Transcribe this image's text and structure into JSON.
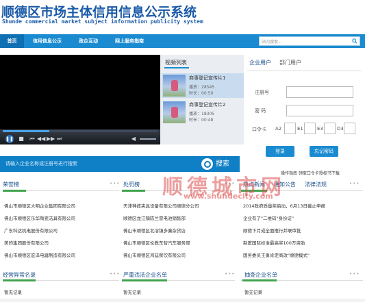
{
  "header": {
    "title": "顺德区市场主体信用信息公示系统",
    "subtitle": "Shunde commercial market subject information publicity system"
  },
  "nav": {
    "items": [
      "首页",
      "信用信息公示",
      "政企互动",
      "网上服务指南"
    ],
    "search_placeholder": "站内搜索..."
  },
  "video_list": {
    "title": "视频列表",
    "items": [
      {
        "name": "商事登记宣传片1",
        "plays": "播放：28545",
        "duration": "时长：00:50"
      },
      {
        "name": "商事登记宣传片2",
        "plays": "播放：18305",
        "duration": "时长：00:48"
      }
    ]
  },
  "player": {
    "progress": 0.3
  },
  "login": {
    "tabs": [
      "企业用户",
      "部门用户"
    ],
    "account_label": "注册号",
    "password_label": "密  码",
    "card_label": "口令卡",
    "cells": [
      "A2",
      "E1",
      "E3",
      "D3"
    ],
    "login_button": "登录",
    "forgot_button": "忘记密码",
    "links": "操作指南   领取口令卡授权书下载"
  },
  "search": {
    "placeholder": "请输入企业名称或注册号进行搜索",
    "button": "搜索"
  },
  "watermark": {
    "text": "顺德城市网",
    "url": "www.shundecity.com"
  },
  "columns": {
    "honor": {
      "title": "荣誉榜",
      "rows": [
        "佛山市顺德区大明企业集团有限公司",
        "佛山市顺德区乐华陶瓷洁具有限公司",
        "广东科达机电股份有限公司",
        "美的集团股份有限公司",
        "佛山市顺德区宏泽电器制造有限公司"
      ]
    },
    "hot": {
      "title": "处罚榜",
      "rows": [
        "天津神技夹具设备有限公司顺德分公司",
        "顺德区龙江镇陈兰冒电池销售部",
        "佛山市顺德区北滘镇多廉杂货店",
        "佛山市顺德区伦教东智汽车服务部",
        "佛山市顺德区鸿廷餐饮有限公司"
      ]
    },
    "news": {
      "tabs": [
        "热点新闻",
        "通知公告",
        "法律法规"
      ],
      "rows": [
        "2014政府质量奖启动，6月13日截止申报",
        "企业有了\"二维码\"身份证\"",
        "顺德下月或全面推行并联审批",
        "制度国际标准最高奖100万资助",
        "国务委员王勇肯定商改\"顺德模式\""
      ]
    },
    "abnormal": {
      "title": "经营异常名录",
      "rows": [
        "暂无记录"
      ]
    },
    "serious": {
      "title": "严重违法企业名单",
      "rows": [
        "暂无记录"
      ]
    },
    "spot": {
      "title": "抽查企业名单",
      "rows": [
        "暂无记录"
      ]
    }
  }
}
